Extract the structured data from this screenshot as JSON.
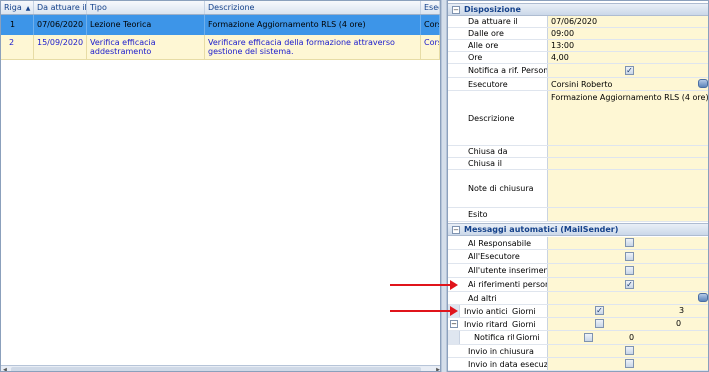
{
  "grid": {
    "columns": [
      "Riga",
      "Da attuare il",
      "Tipo",
      "Descrizione",
      "Esec"
    ],
    "sort_indicator": "▲",
    "rows": [
      {
        "riga": "1",
        "date": "07/06/2020",
        "tipo": "Lezione Teorica",
        "descrizione": "Formazione Aggiornamento RLS (4 ore)",
        "esec": "Corsi"
      },
      {
        "riga": "2",
        "date": "15/09/2020",
        "tipo": "Verifica efficacia addestramento",
        "descrizione": "Verificare efficacia della formazione attraverso gestione del sistema.",
        "esec": "Corsi"
      }
    ]
  },
  "disposizione": {
    "title": "Disposizione",
    "toggle": "−",
    "fields": {
      "da_attuare_il": {
        "label": "Da attuare il",
        "value": "07/06/2020"
      },
      "dalle_ore": {
        "label": "Dalle ore",
        "value": "09:00"
      },
      "alle_ore": {
        "label": "Alle ore",
        "value": "13:00"
      },
      "ore": {
        "label": "Ore",
        "value": "4,00"
      },
      "notifica": {
        "label": "Notifica a rif. Personale",
        "checked": true
      },
      "esecutore": {
        "label": "Esecutore",
        "value": "Corsini Roberto"
      },
      "descrizione": {
        "label": "Descrizione",
        "value": "Formazione Aggiornamento RLS (4 ore)"
      },
      "chiusa_da": {
        "label": "Chiusa da",
        "value": ""
      },
      "chiusa_il": {
        "label": "Chiusa il",
        "value": ""
      },
      "note": {
        "label": "Note di chiusura",
        "value": ""
      },
      "esito": {
        "label": "Esito",
        "value": ""
      }
    }
  },
  "messaggi": {
    "title": "Messaggi automatici (MailSender)",
    "toggle": "−",
    "al_responsabile": {
      "label": "Al Responsabile",
      "checked": false
    },
    "all_esecutore": {
      "label": "All'Esecutore",
      "checked": false
    },
    "all_utente": {
      "label": "All'utente inserimento",
      "checked": false
    },
    "ai_riferimenti": {
      "label": "Ai riferimenti personale",
      "checked": true
    },
    "ad_altri": {
      "label": "Ad altri"
    },
    "invio_anticipato": {
      "label": "Invio anticipato",
      "sub_label": "Giorni",
      "checked": true,
      "value": "3",
      "expander": "−"
    },
    "invio_ritardo": {
      "label": "Invio ritardo",
      "sub_label": "Giorni",
      "checked": false,
      "value": "0",
      "expander": "−"
    },
    "notifica_ritardo": {
      "label": "Notifica ritardo",
      "sub_label": "Giorni",
      "checked": false,
      "value": "0"
    },
    "invio_chiusura": {
      "label": "Invio in chiusura",
      "checked": false
    },
    "invio_data_esecuzione": {
      "label": "Invio in data esecuzione",
      "checked": false
    }
  },
  "colors": {
    "selected_row": "#3d95e8",
    "value_bg": "#fef7d4",
    "arrow": "#e0141b",
    "header_text": "#15428b"
  }
}
